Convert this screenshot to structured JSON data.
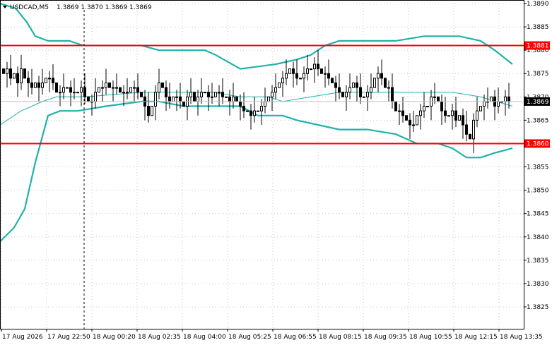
{
  "header": {
    "symbol": "USDCAD,M5",
    "ohlc": "1.3869 1.3870 1.3869 1.3869"
  },
  "colors": {
    "background": "#ffffff",
    "grid": "#c8c8c8",
    "candle": "#000000",
    "bollinger": "#20b2aa",
    "level_line": "#ff0000",
    "level_tag_bg": "#ff0000",
    "level_tag_text": "#ffffff",
    "price_tag_bg": "#000000",
    "price_tag_text": "#ffffff"
  },
  "chart_data": {
    "type": "candlestick",
    "symbol": "USDCAD",
    "timeframe": "M5",
    "ylim": [
      1.3819,
      1.3891
    ],
    "y_ticks": [
      "1.3890",
      "1.3885",
      "1.3880",
      "1.3875",
      "1.3870",
      "1.3865",
      "1.3860",
      "1.3855",
      "1.3850",
      "1.3845",
      "1.3840",
      "1.3835",
      "1.3830",
      "1.3825"
    ],
    "x_ticks": [
      "17 Aug 2026",
      "17 Aug 22:50",
      "18 Aug 00:20",
      "18 Aug 02:35",
      "18 Aug 04:00",
      "18 Aug 05:25",
      "18 Aug 06:55",
      "18 Aug 08:15",
      "18 Aug 09:35",
      "18 Aug 10:55",
      "18 Aug 12:15",
      "18 Aug 13:35"
    ],
    "horizontal_levels": [
      {
        "value": 1.3881,
        "label": "1.3881"
      },
      {
        "value": 1.386,
        "label": "1.3860"
      }
    ],
    "current_price": {
      "value": 1.3869,
      "label": "1.3869"
    },
    "closes": [
      1.3875,
      1.3876,
      1.3874,
      1.3875,
      1.3873,
      1.3876,
      1.3874,
      1.3873,
      1.3872,
      1.3873,
      1.3872,
      1.3873,
      1.3874,
      1.3874,
      1.3873,
      1.3871,
      1.3871,
      1.3872,
      1.3872,
      1.3871,
      1.3871,
      1.3871,
      1.3872,
      1.387,
      1.3869,
      1.3869,
      1.3871,
      1.3872,
      1.3872,
      1.3873,
      1.3872,
      1.3872,
      1.3872,
      1.3871,
      1.3871,
      1.3871,
      1.3872,
      1.3872,
      1.3871,
      1.387,
      1.3868,
      1.3866,
      1.3868,
      1.3871,
      1.3873,
      1.3872,
      1.387,
      1.3869,
      1.387,
      1.387,
      1.3869,
      1.3868,
      1.387,
      1.3871,
      1.3869,
      1.387,
      1.3871,
      1.3871,
      1.387,
      1.387,
      1.3871,
      1.3871,
      1.387,
      1.387,
      1.3869,
      1.387,
      1.3869,
      1.3868,
      1.3867,
      1.3867,
      1.3866,
      1.3867,
      1.3867,
      1.3868,
      1.3869,
      1.387,
      1.3871,
      1.3872,
      1.3873,
      1.3874,
      1.3875,
      1.3876,
      1.3875,
      1.3874,
      1.3874,
      1.3875,
      1.3876,
      1.3876,
      1.3877,
      1.3876,
      1.3875,
      1.3875,
      1.3874,
      1.3873,
      1.3872,
      1.3871,
      1.387,
      1.3871,
      1.3872,
      1.3873,
      1.3872,
      1.387,
      1.387,
      1.3871,
      1.3872,
      1.3874,
      1.3875,
      1.3874,
      1.3872,
      1.3872,
      1.3869,
      1.3867,
      1.3867,
      1.3866,
      1.3865,
      1.3864,
      1.3864,
      1.3866,
      1.3867,
      1.3868,
      1.3868,
      1.387,
      1.387,
      1.3869,
      1.3867,
      1.3866,
      1.3866,
      1.3867,
      1.3865,
      1.3866,
      1.3864,
      1.3862,
      1.3861,
      1.3865,
      1.3867,
      1.3868,
      1.3869,
      1.3869,
      1.387,
      1.3868,
      1.3869,
      1.3869,
      1.387,
      1.3869
    ],
    "bb_upper": [
      [
        0,
        1.389
      ],
      [
        22,
        1.3889
      ],
      [
        38,
        1.3886
      ],
      [
        50,
        1.3883
      ],
      [
        68,
        1.3882
      ],
      [
        98,
        1.3882
      ],
      [
        118,
        1.3881
      ],
      [
        200,
        1.3881
      ],
      [
        225,
        1.388
      ],
      [
        290,
        1.388
      ],
      [
        305,
        1.3879
      ],
      [
        340,
        1.3876
      ],
      [
        390,
        1.3877
      ],
      [
        420,
        1.3878
      ],
      [
        440,
        1.3879
      ],
      [
        460,
        1.3881
      ],
      [
        480,
        1.3882
      ],
      [
        560,
        1.3882
      ],
      [
        600,
        1.3883
      ],
      [
        650,
        1.3883
      ],
      [
        680,
        1.3882
      ],
      [
        700,
        1.388
      ],
      [
        725,
        1.3877
      ]
    ],
    "bb_middle": [
      [
        0,
        1.3864
      ],
      [
        30,
        1.3867
      ],
      [
        60,
        1.3869
      ],
      [
        80,
        1.387
      ],
      [
        120,
        1.387
      ],
      [
        200,
        1.3871
      ],
      [
        260,
        1.3871
      ],
      [
        300,
        1.3871
      ],
      [
        340,
        1.387
      ],
      [
        380,
        1.387
      ],
      [
        400,
        1.3869
      ],
      [
        440,
        1.387
      ],
      [
        480,
        1.3871
      ],
      [
        520,
        1.3871
      ],
      [
        560,
        1.3871
      ],
      [
        600,
        1.3871
      ],
      [
        640,
        1.3871
      ],
      [
        680,
        1.387
      ],
      [
        725,
        1.3868
      ]
    ],
    "bb_lower": [
      [
        0,
        1.3839
      ],
      [
        20,
        1.3842
      ],
      [
        35,
        1.3846
      ],
      [
        50,
        1.3856
      ],
      [
        68,
        1.3866
      ],
      [
        85,
        1.3867
      ],
      [
        110,
        1.3867
      ],
      [
        150,
        1.3868
      ],
      [
        200,
        1.3869
      ],
      [
        225,
        1.3869
      ],
      [
        260,
        1.3868
      ],
      [
        300,
        1.3868
      ],
      [
        340,
        1.3868
      ],
      [
        365,
        1.3866
      ],
      [
        400,
        1.3866
      ],
      [
        420,
        1.3865
      ],
      [
        450,
        1.3864
      ],
      [
        480,
        1.3863
      ],
      [
        520,
        1.3863
      ],
      [
        560,
        1.3862
      ],
      [
        590,
        1.386
      ],
      [
        620,
        1.386
      ],
      [
        640,
        1.3859
      ],
      [
        660,
        1.3857
      ],
      [
        680,
        1.3857
      ],
      [
        700,
        1.3858
      ],
      [
        725,
        1.3859
      ]
    ]
  }
}
